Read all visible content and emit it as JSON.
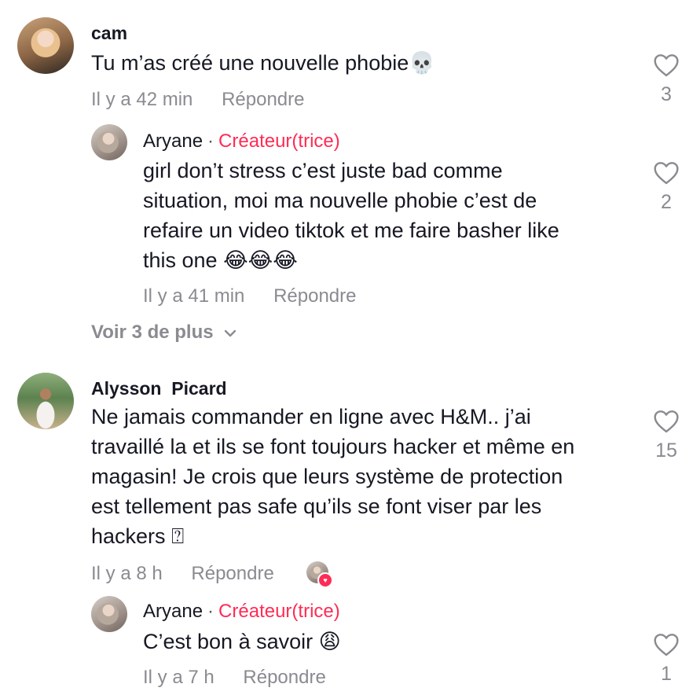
{
  "comments": [
    {
      "username": "cam",
      "text": "Tu m’as créé une nouvelle phobie",
      "emoji": "💀",
      "time": "Il y a 42 min",
      "reply_label": "Répondre",
      "likes": "3",
      "replies": [
        {
          "username": "Aryane",
          "separator": "·",
          "badge": "Créateur(trice)",
          "lines": [
            "girl don’t stress c’est juste bad comme",
            "situation, moi ma nouvelle phobie c’est de",
            "refaire un video tiktok et me faire basher like",
            "this one"
          ],
          "emoji": "😂😂😂",
          "time": "Il y a 41 min",
          "reply_label": "Répondre",
          "likes": "2"
        }
      ],
      "more_replies": "Voir 3 de plus"
    },
    {
      "username": "Alysson  Picard",
      "lines": [
        "Ne jamais commander en ligne avec H&M.. j’ai",
        "travaillé la et ils se font toujours hacker et même en",
        "magasin! Je crois que leurs système de protection",
        "est tellement pas safe qu’ils se font viser par les",
        "hackers"
      ],
      "emoji": "⍰",
      "time": "Il y a 8 h",
      "reply_label": "Répondre",
      "likes": "15",
      "replies": [
        {
          "username": "Aryane",
          "separator": "·",
          "badge": "Créateur(trice)",
          "text": "C’est bon à savoir",
          "emoji": "😩",
          "time": "Il y a 7 h",
          "reply_label": "Répondre",
          "likes": "1"
        }
      ]
    }
  ],
  "icons": {
    "like": "heart-outline-icon",
    "expand": "chevron-down-icon",
    "creator_liked": "creator-liked-heart-icon"
  },
  "colors": {
    "accent": "#fe2c55",
    "muted": "#8a8b91",
    "text": "#161823"
  }
}
